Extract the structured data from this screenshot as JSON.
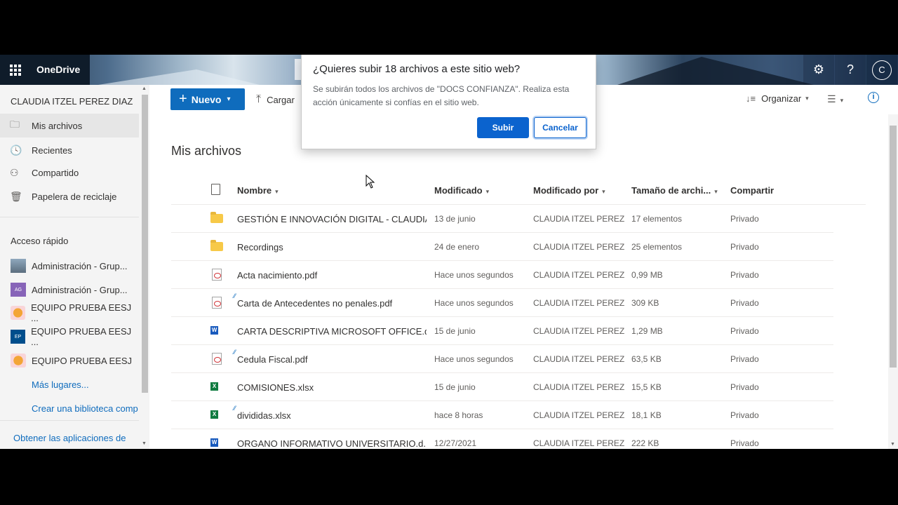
{
  "app": {
    "name": "OneDrive",
    "user_initial": "C"
  },
  "colors": {
    "accent": "#0f6cbd",
    "folder": "#f7c948",
    "pdf": "#d13438",
    "word": "#185abd",
    "excel": "#107c41"
  },
  "sidebar": {
    "user_name": "CLAUDIA ITZEL PEREZ DIAZ",
    "nav": [
      {
        "label": "Mis archivos",
        "icon": "folder-icon"
      },
      {
        "label": "Recientes",
        "icon": "clock-icon"
      },
      {
        "label": "Compartido",
        "icon": "people-icon"
      },
      {
        "label": "Papelera de reciclaje",
        "icon": "recycle-bin-icon"
      }
    ],
    "quick_access_title": "Acceso rápido",
    "quick_access": [
      {
        "label": "Administración - Grup...",
        "badge": ""
      },
      {
        "label": "Administración - Grup...",
        "badge": "AG"
      },
      {
        "label": "EQUIPO PRUEBA EESJ ...",
        "badge": ""
      },
      {
        "label": "EQUIPO PRUEBA EESJ ...",
        "badge": "EP"
      },
      {
        "label": "EQUIPO PRUEBA EESJ",
        "badge": ""
      }
    ],
    "more_places": "Más lugares...",
    "create_library": "Crear una biblioteca comp",
    "get_apps": "Obtener las aplicaciones de"
  },
  "toolbar": {
    "new_label": "Nuevo",
    "upload_label": "Cargar",
    "sort_label": "Organizar"
  },
  "main": {
    "title": "Mis archivos",
    "columns": {
      "name": "Nombre",
      "modified": "Modificado",
      "modified_by": "Modificado por",
      "size": "Tamaño de archi...",
      "sharing": "Compartir"
    },
    "rows": [
      {
        "type": "folder",
        "name": "GESTIÓN E INNOVACIÓN DIGITAL - CLAUDIA",
        "modified": "13 de junio",
        "modified_by": "CLAUDIA ITZEL PEREZ DIA",
        "size": "17 elementos",
        "sharing": "Privado"
      },
      {
        "type": "folder",
        "name": "Recordings",
        "modified": "24 de enero",
        "modified_by": "CLAUDIA ITZEL PEREZ DIA",
        "size": "25 elementos",
        "sharing": "Privado"
      },
      {
        "type": "pdf",
        "name": "Acta nacimiento.pdf",
        "modified": "Hace unos segundos",
        "modified_by": "CLAUDIA ITZEL PEREZ DIA",
        "size": "0,99 MB",
        "sharing": "Privado"
      },
      {
        "type": "pdf",
        "name": "Carta de Antecedentes no penales.pdf",
        "modified": "Hace unos segundos",
        "modified_by": "CLAUDIA ITZEL PEREZ DIA",
        "size": "309 KB",
        "sharing": "Privado"
      },
      {
        "type": "docx",
        "name": "CARTA DESCRIPTIVA MICROSOFT OFFICE.d...",
        "modified": "15 de junio",
        "modified_by": "CLAUDIA ITZEL PEREZ DIA",
        "size": "1,29 MB",
        "sharing": "Privado"
      },
      {
        "type": "pdf",
        "name": "Cedula Fiscal.pdf",
        "modified": "Hace unos segundos",
        "modified_by": "CLAUDIA ITZEL PEREZ DIA",
        "size": "63,5 KB",
        "sharing": "Privado"
      },
      {
        "type": "xlsx",
        "name": "COMISIONES.xlsx",
        "modified": "15 de junio",
        "modified_by": "CLAUDIA ITZEL PEREZ DIA",
        "size": "15,5 KB",
        "sharing": "Privado"
      },
      {
        "type": "xlsx",
        "name": "divididas.xlsx",
        "modified": "hace 8 horas",
        "modified_by": "CLAUDIA ITZEL PEREZ DIA",
        "size": "18,1 KB",
        "sharing": "Privado"
      },
      {
        "type": "docx",
        "name": "ORGANO INFORMATIVO UNIVERSITARIO.d...",
        "modified": "12/27/2021",
        "modified_by": "CLAUDIA ITZEL PEREZ DIA",
        "size": "222 KB",
        "sharing": "Privado"
      }
    ]
  },
  "dialog": {
    "title": "¿Quieres subir 18 archivos a este sitio web?",
    "message": "Se subirán todos los archivos de \"DOCS CONFIANZA\". Realiza esta acción únicamente si confías en el sitio web.",
    "confirm_label": "Subir",
    "cancel_label": "Cancelar"
  }
}
